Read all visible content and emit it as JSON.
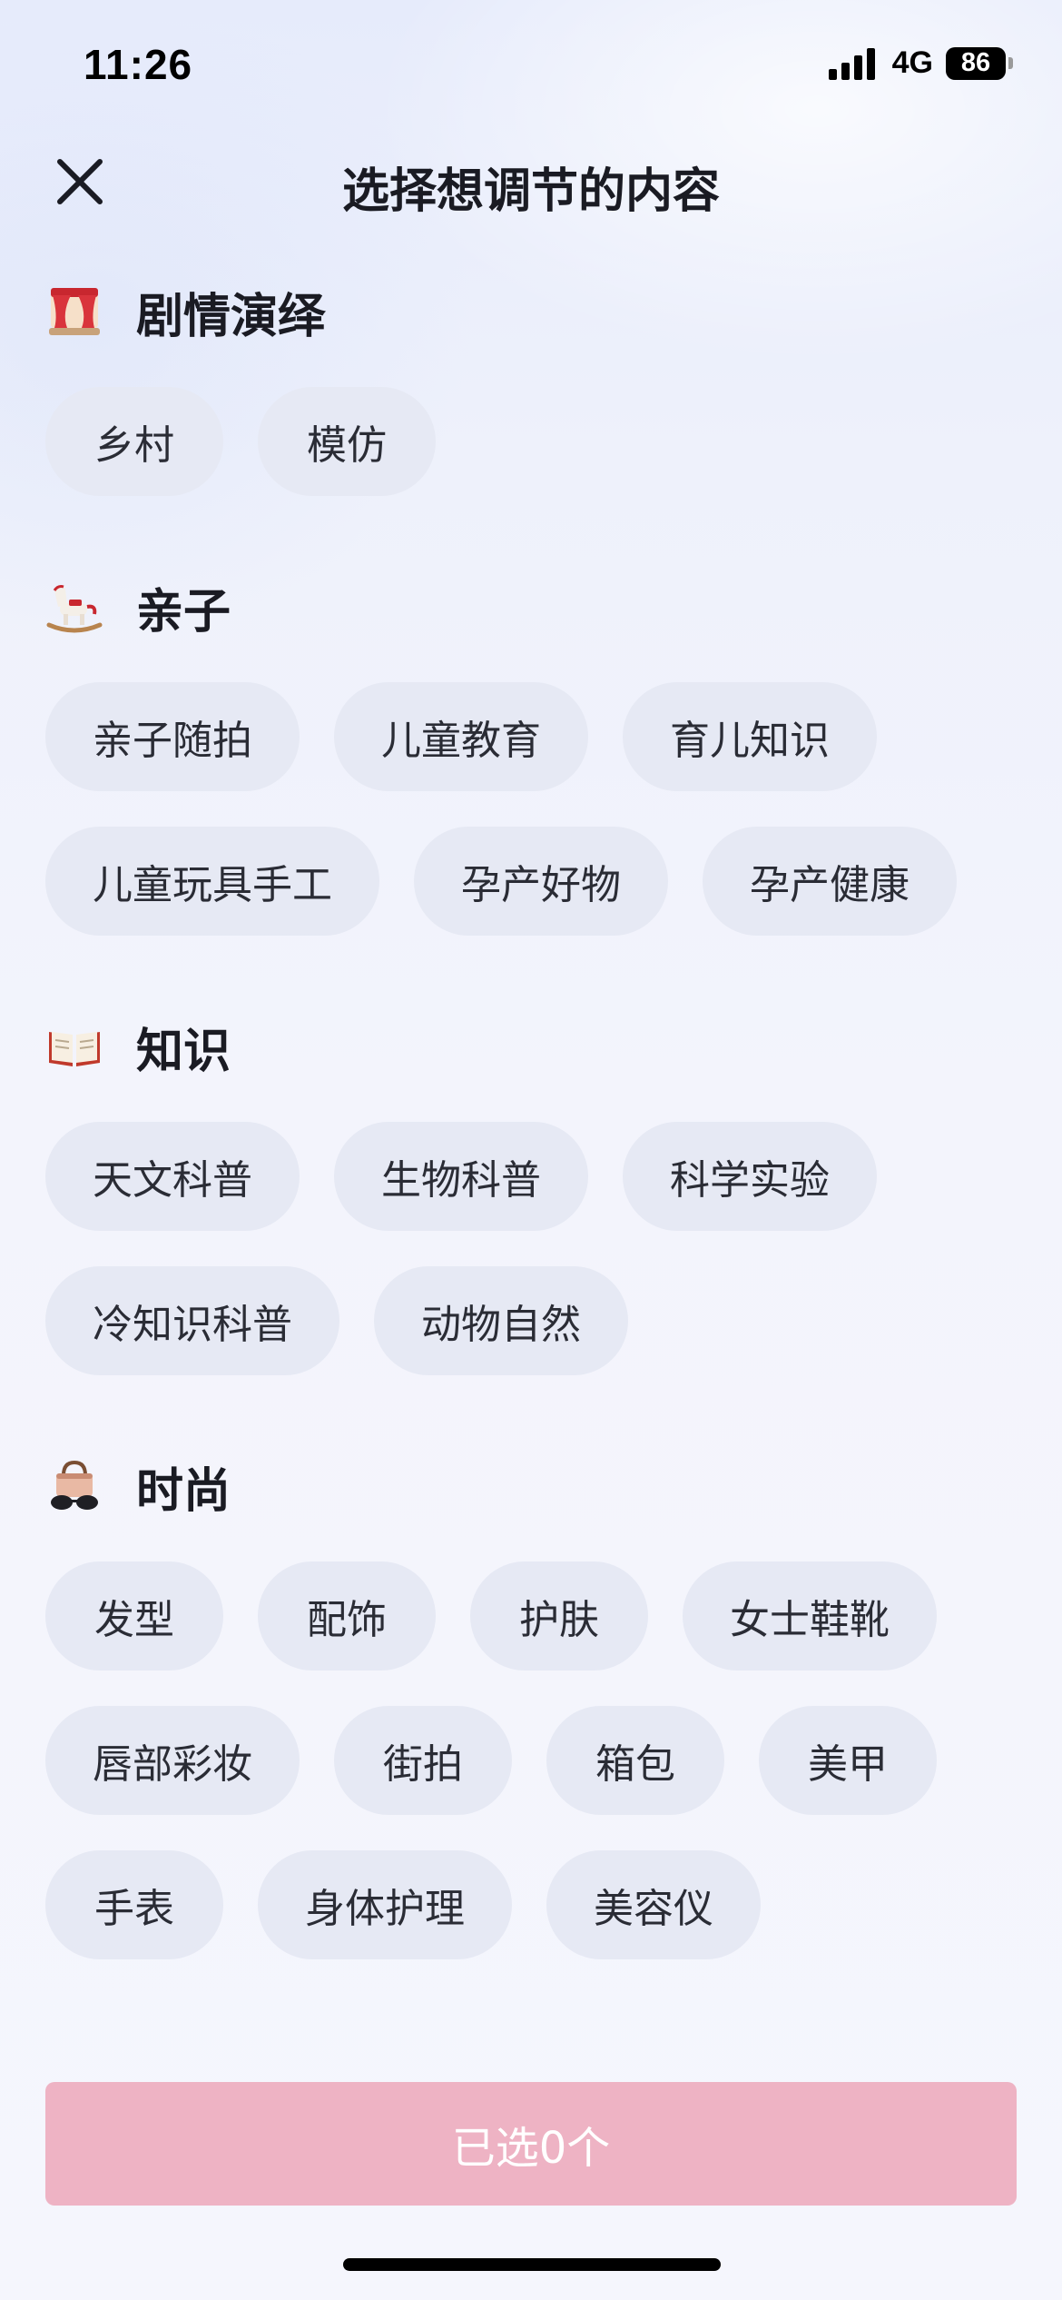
{
  "status_bar": {
    "time": "11:26",
    "network": "4G",
    "battery": "86"
  },
  "header": {
    "title": "选择想调节的内容"
  },
  "sections": [
    {
      "title": "剧情演绎",
      "icon": "theater-curtain-icon",
      "chips": [
        "乡村",
        "模仿"
      ]
    },
    {
      "title": "亲子",
      "icon": "rocking-horse-icon",
      "chips": [
        "亲子随拍",
        "儿童教育",
        "育儿知识",
        "儿童玩具手工",
        "孕产好物",
        "孕产健康"
      ]
    },
    {
      "title": "知识",
      "icon": "open-book-icon",
      "chips": [
        "天文科普",
        "生物科普",
        "科学实验",
        "冷知识科普",
        "动物自然"
      ]
    },
    {
      "title": "时尚",
      "icon": "handbag-sunglasses-icon",
      "chips": [
        "发型",
        "配饰",
        "护肤",
        "女士鞋靴",
        "唇部彩妆",
        "街拍",
        "箱包",
        "美甲",
        "手表",
        "身体护理",
        "美容仪"
      ]
    }
  ],
  "footer": {
    "confirm_label": "已选0个"
  },
  "colors": {
    "chip_bg": "#e6e9f4",
    "button_bg": "#eeb3c4",
    "button_text": "#ffffff"
  }
}
